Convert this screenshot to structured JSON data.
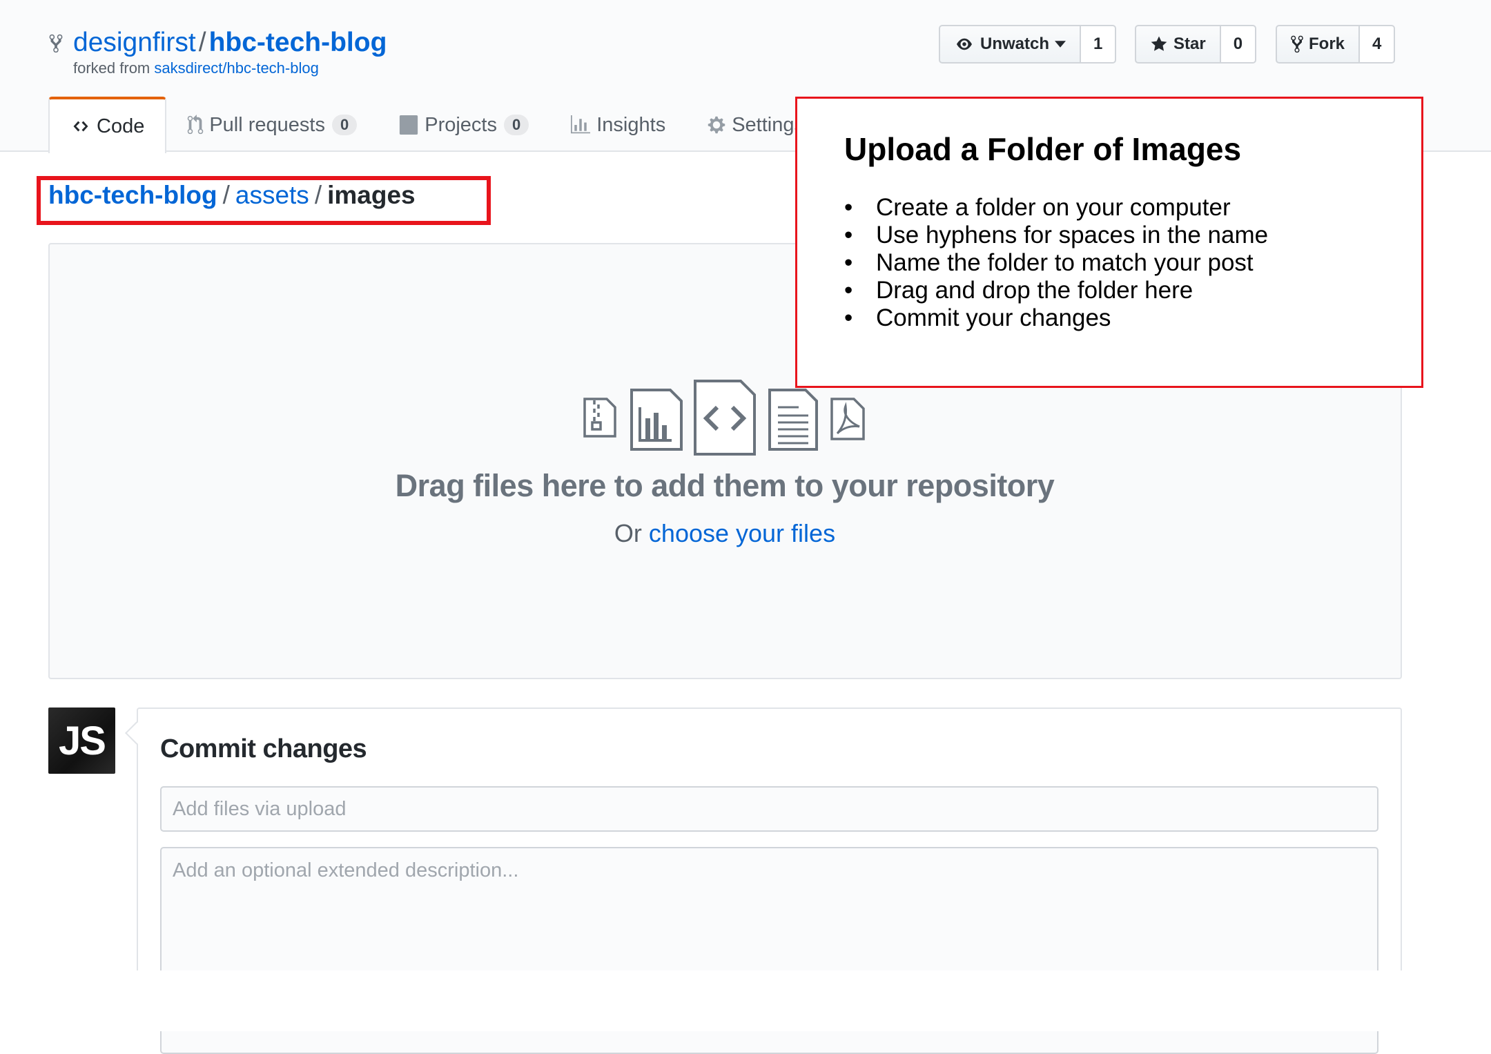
{
  "repo": {
    "owner": "designfirst",
    "separator": "/",
    "name": "hbc-tech-blog",
    "forked_prefix": "forked from",
    "forked_source": "saksdirect/hbc-tech-blog"
  },
  "actions": {
    "watch_label": "Unwatch",
    "watch_count": "1",
    "star_label": "Star",
    "star_count": "0",
    "fork_label": "Fork",
    "fork_count": "4"
  },
  "tabs": [
    {
      "label": "Code"
    },
    {
      "label": "Pull requests",
      "count": "0"
    },
    {
      "label": "Projects",
      "count": "0"
    },
    {
      "label": "Insights"
    },
    {
      "label": "Settings"
    }
  ],
  "breadcrumb": {
    "root": "hbc-tech-blog",
    "sep": "/",
    "folder": "assets",
    "current": "images"
  },
  "dropzone": {
    "title": "Drag files here to add them to your repository",
    "or_text": "Or ",
    "choose_link": "choose your files"
  },
  "callout": {
    "title": "Upload a Folder of Images",
    "bullet": "•",
    "items": [
      "Create a folder on your computer",
      "Use hyphens for spaces in the name",
      "Name the folder to match your post",
      "Drag and drop the folder here",
      "Commit your changes"
    ]
  },
  "commit": {
    "avatar_initials": "JS",
    "title": "Commit changes",
    "summary_placeholder": "Add files via upload",
    "description_placeholder": "Add an optional extended description..."
  },
  "colors": {
    "link": "#0366d6",
    "annotation_red": "#e8141c",
    "tab_accent": "#e36209"
  }
}
